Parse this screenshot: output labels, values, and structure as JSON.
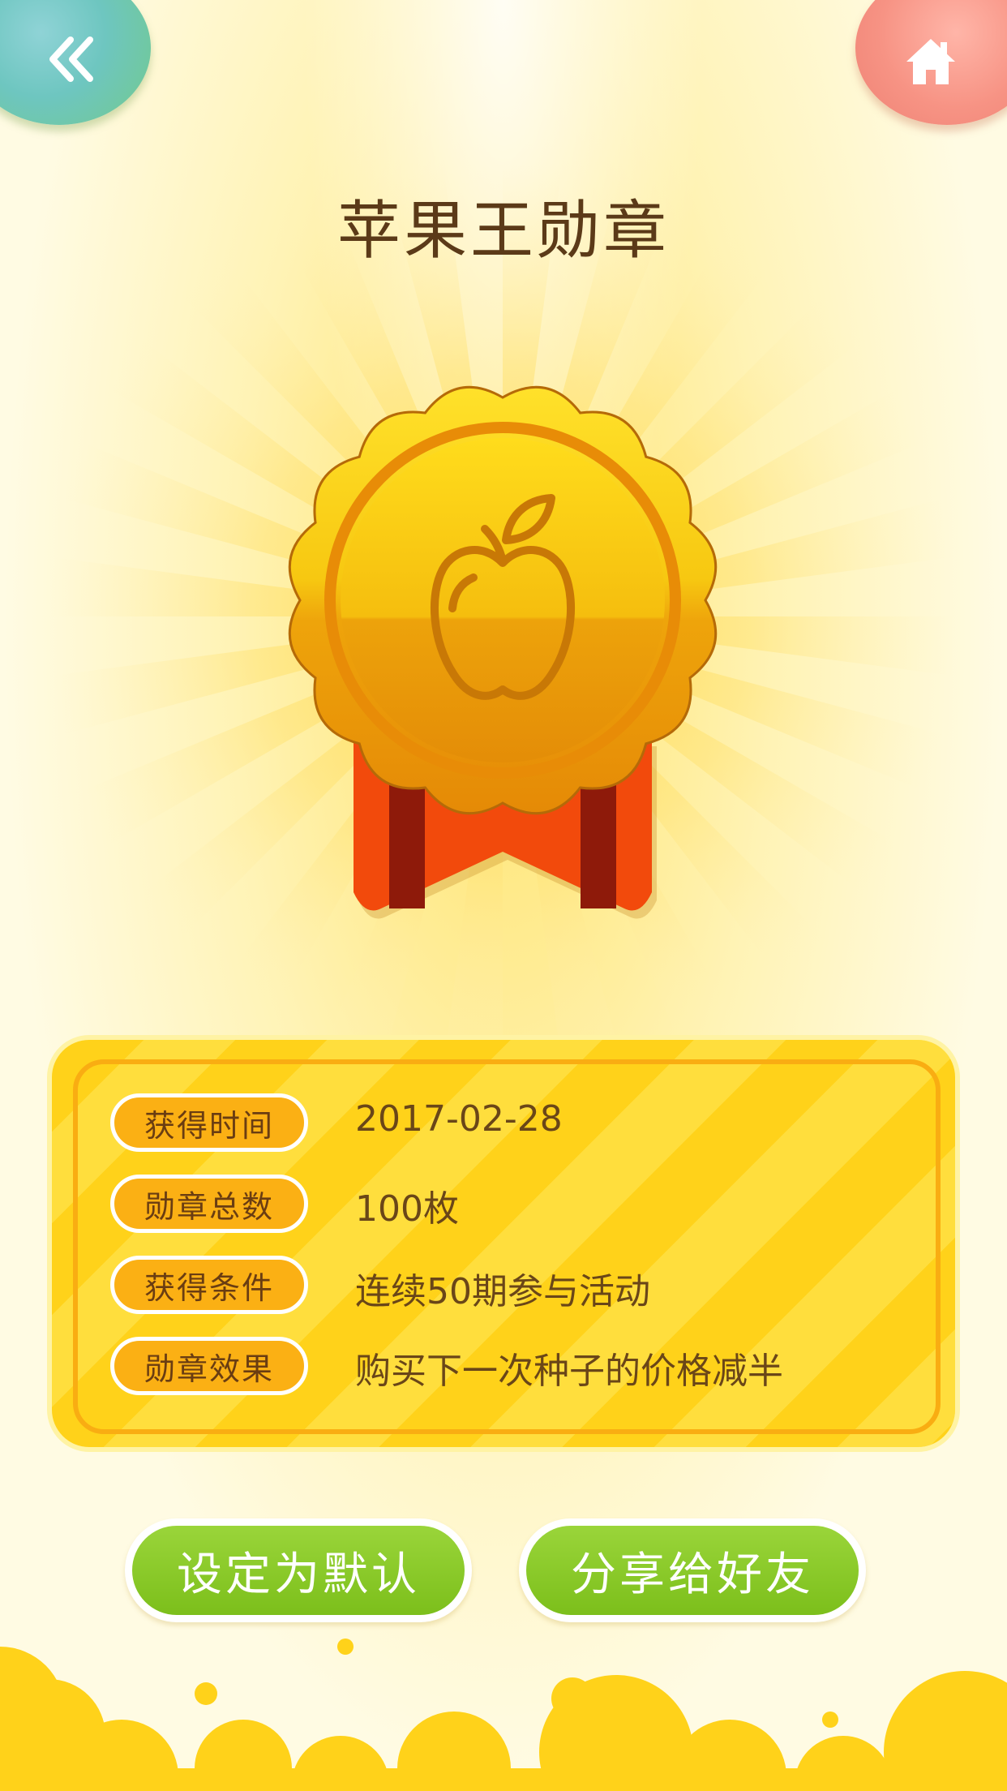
{
  "nav": {
    "back_icon": "double-chevron-left-icon",
    "home_icon": "home-icon"
  },
  "title": "苹果王勋章",
  "medal": {
    "icon": "apple-icon"
  },
  "info": [
    {
      "label": "获得时间",
      "value": "2017-02-28"
    },
    {
      "label": "勋章总数",
      "value": "100枚"
    },
    {
      "label": "获得条件",
      "value": "连续50期参与活动"
    },
    {
      "label": "勋章效果",
      "value": "购买下一次种子的价格减半"
    }
  ],
  "buttons": {
    "set_default": "设定为默认",
    "share": "分享给好友"
  },
  "colors": {
    "accent_green": "#7cbf1b",
    "medal_gold": "#f2b60e",
    "ribbon_red": "#f04a0c",
    "card_yellow": "#ffd21a",
    "pill_orange": "#fbb014",
    "text_brown": "#5b3a18"
  }
}
